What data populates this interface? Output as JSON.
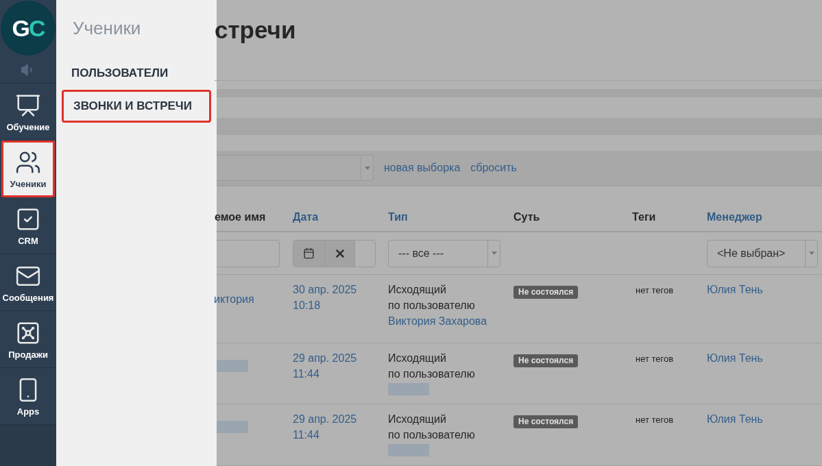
{
  "logo": {
    "text": "GC"
  },
  "nav": [
    {
      "label": "Обучение",
      "selected": false
    },
    {
      "label": "Ученики",
      "selected": true
    },
    {
      "label": "CRM",
      "selected": false
    },
    {
      "label": "Сообщения",
      "selected": false
    },
    {
      "label": "Продажи",
      "selected": false
    },
    {
      "label": "Apps",
      "selected": false
    }
  ],
  "flyout": {
    "title": "Ученики",
    "items": [
      {
        "label": "ПОЛЬЗОВАТЕЛИ",
        "selected": false
      },
      {
        "label": "ЗВОНКИ И ВСТРЕЧИ",
        "selected": true
      }
    ]
  },
  "page": {
    "title": "стречи"
  },
  "filter_bar": {
    "links": [
      "новая выборка",
      "сбросить"
    ]
  },
  "table": {
    "columns": [
      {
        "label": "емое имя",
        "sortable": false
      },
      {
        "label": "Дата",
        "sortable": true
      },
      {
        "label": "Тип",
        "sortable": true
      },
      {
        "label": "Суть",
        "sortable": false
      },
      {
        "label": "Теги",
        "sortable": false
      },
      {
        "label": "Менеджер",
        "sortable": true
      }
    ],
    "filters": {
      "type_select": "--- все ---",
      "manager_select": "<Не выбран>"
    },
    "rows": [
      {
        "name": "иктория",
        "name_hidden": false,
        "date": "30 апр. 2025",
        "time": "10:18",
        "type": "Исходящий",
        "type_detail": "по пользователю",
        "user": "Виктория Захарова",
        "user_hidden": false,
        "status": "Не состоялся",
        "tags": "нет тегов",
        "manager": "Юлия Тень"
      },
      {
        "name_hidden": true,
        "date": "29 апр. 2025",
        "time": "11:44",
        "type": "Исходящий",
        "type_detail": "по пользователю",
        "user_hidden": true,
        "status": "Не состоялся",
        "tags": "нет тегов",
        "manager": "Юлия Тень"
      },
      {
        "name_hidden": true,
        "date": "29 апр. 2025",
        "time": "11:44",
        "type": "Исходящий",
        "type_detail": "по пользователю",
        "user_hidden": true,
        "status": "Не состоялся",
        "tags": "нет тегов",
        "manager": "Юлия Тень"
      }
    ]
  }
}
